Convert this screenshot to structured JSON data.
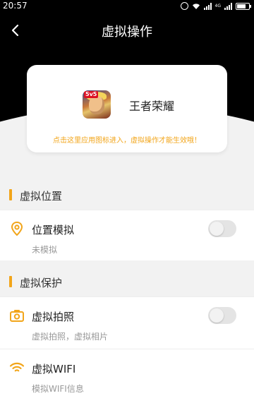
{
  "status_bar": {
    "time": "20:57",
    "network_label": "4G"
  },
  "nav": {
    "title": "虚拟操作"
  },
  "app_card": {
    "badge": "5v5",
    "app_name": "王者荣耀",
    "hint": "点击这里应用图标进入，虚拟操作才能生效哦！"
  },
  "sections": [
    {
      "title": "虚拟位置",
      "rows": [
        {
          "title": "位置模拟",
          "subtitle": "未模拟",
          "icon": "location-pin-icon",
          "toggle_on": false
        }
      ]
    },
    {
      "title": "虚拟保护",
      "rows": [
        {
          "title": "虚拟拍照",
          "subtitle": "虚拟拍照，虚拟相片",
          "icon": "camera-icon",
          "toggle_on": false
        },
        {
          "title": "虚拟WIFI",
          "subtitle": "模拟WIFI信息",
          "icon": "wifi-icon",
          "toggle_on": null
        }
      ]
    }
  ],
  "colors": {
    "accent": "#f2a51a",
    "header": "#000000",
    "background": "#f2f2f2"
  }
}
